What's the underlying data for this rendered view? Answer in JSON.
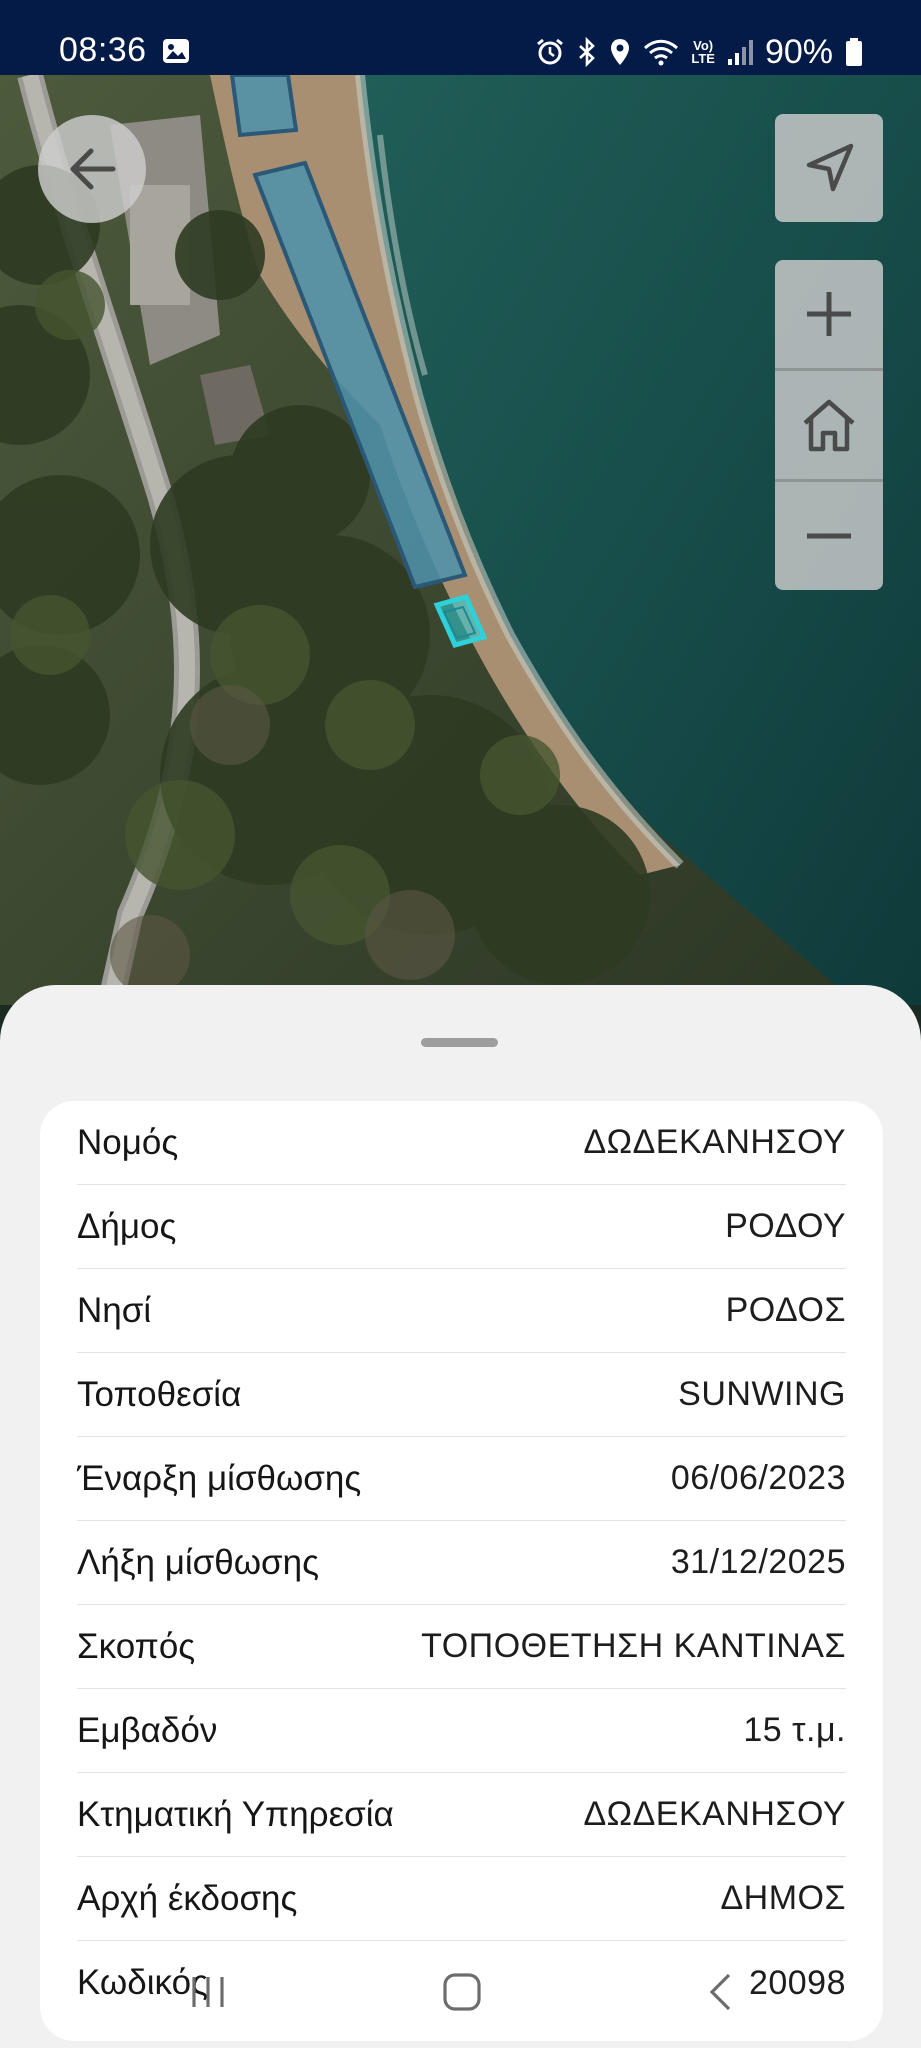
{
  "status_bar": {
    "time": "08:36",
    "battery": "90%",
    "lte_top": "Vo)",
    "lte_bottom": "LTE",
    "icons": [
      "gallery-icon",
      "alarm-icon",
      "bluetooth-icon",
      "location-icon",
      "wifi-icon",
      "signal-icon",
      "battery-icon"
    ]
  },
  "map": {
    "controls": [
      "back-button",
      "locate-button",
      "zoom-in-button",
      "home-button",
      "zoom-out-button"
    ],
    "highlight_color": "#2fd0d8",
    "zone_color": "#4d93ab"
  },
  "details": {
    "rows": [
      {
        "label": "Νομός",
        "value": "ΔΩΔΕΚΑΝΗΣΟΥ"
      },
      {
        "label": "Δήμος",
        "value": "ΡΟΔΟΥ"
      },
      {
        "label": "Νησί",
        "value": "ΡΟΔΟΣ"
      },
      {
        "label": "Τοποθεσία",
        "value": "SUNWING"
      },
      {
        "label": "Έναρξη μίσθωσης",
        "value": "06/06/2023"
      },
      {
        "label": "Λήξη μίσθωσης",
        "value": "31/12/2025"
      },
      {
        "label": "Σκοπός",
        "value": "ΤΟΠΟΘΕΤΗΣΗ ΚΑΝΤΙΝΑΣ"
      },
      {
        "label": "Εμβαδόν",
        "value": "15 τ.μ."
      },
      {
        "label": "Κτηματική Υπηρεσία",
        "value": "ΔΩΔΕΚΑΝΗΣΟΥ"
      },
      {
        "label": "Αρχή έκδοσης",
        "value": "ΔΗΜΟΣ"
      },
      {
        "label": "Κωδικός",
        "value": "20098"
      }
    ]
  },
  "system_nav": [
    "recent-apps-button",
    "home-nav-button",
    "back-nav-button"
  ]
}
